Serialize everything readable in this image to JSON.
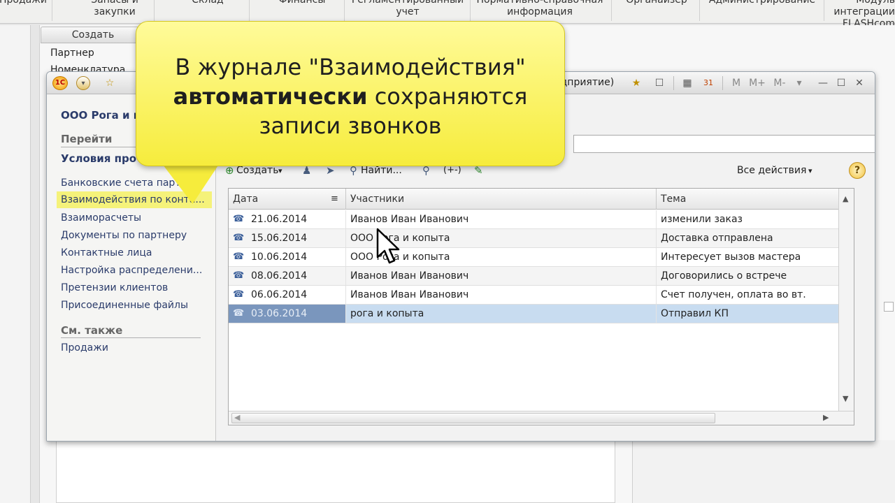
{
  "top_menu": [
    {
      "label": "Продажи"
    },
    {
      "label": "Запасы и закупки"
    },
    {
      "label": "Склад"
    },
    {
      "label": "Финансы"
    },
    {
      "label": "Регламентированный учет"
    },
    {
      "label": "Нормативно-справочная информация"
    },
    {
      "label": "Органайзер"
    },
    {
      "label": "Администрирование"
    },
    {
      "label": "Модуль интеграции FLASHcom"
    }
  ],
  "background": {
    "create_tab": "Создать",
    "link_partner": "Партнер",
    "link_nomenclature": "Номенклатура"
  },
  "window": {
    "title_fragment": "едприятие)",
    "toolbar_glyphs": [
      "М",
      "М+",
      "М-"
    ],
    "org_name": "ООО Рога и к",
    "nav_goto_header": "Перейти",
    "nav_conditions": "Условия про",
    "nav_items": [
      "Банковские счета партне...",
      "Взаимодействия по конта...",
      "Взаиморасчеты",
      "Документы по партнеру",
      "Контактные лица",
      "Настройка распределени...",
      "Претензии клиентов",
      "Присоединенные файлы"
    ],
    "nav_see_also": "См. также",
    "nav_sales": "Продажи",
    "toolbar": {
      "create_label": "Создать",
      "find_label": "Найти...",
      "all_actions_label": "Все действия",
      "plusminus_label": "(+-)"
    },
    "grid": {
      "columns": [
        "Дата",
        "Участники",
        "Тема"
      ],
      "rows": [
        {
          "date": "21.06.2014",
          "participants": "Иванов Иван Иванович",
          "subject": "изменили заказ"
        },
        {
          "date": "15.06.2014",
          "participants": "ООО Рога и копыта",
          "subject": "Доставка отправлена"
        },
        {
          "date": "10.06.2014",
          "participants": "ООО Рога и копыта",
          "subject": "Интересует вызов мастера"
        },
        {
          "date": "08.06.2014",
          "participants": "Иванов Иван Иванович",
          "subject": "Договорились о встрече"
        },
        {
          "date": "06.06.2014",
          "participants": "Иванов Иван Иванович",
          "subject": "Счет получен, оплата во вт."
        },
        {
          "date": "03.06.2014",
          "participants": "рога и копыта",
          "subject": "Отправил КП"
        }
      ],
      "selected_row": 5
    }
  },
  "callout": {
    "line1": "В журнале \"Взаимодействия\"",
    "line2_bold": "автоматически",
    "line2_rest": " сохраняются",
    "line3": "записи звонков"
  },
  "icons": {
    "row_icon": "phone-call-icon",
    "search": "search-icon",
    "clear": "close-icon",
    "help": "help-icon"
  }
}
